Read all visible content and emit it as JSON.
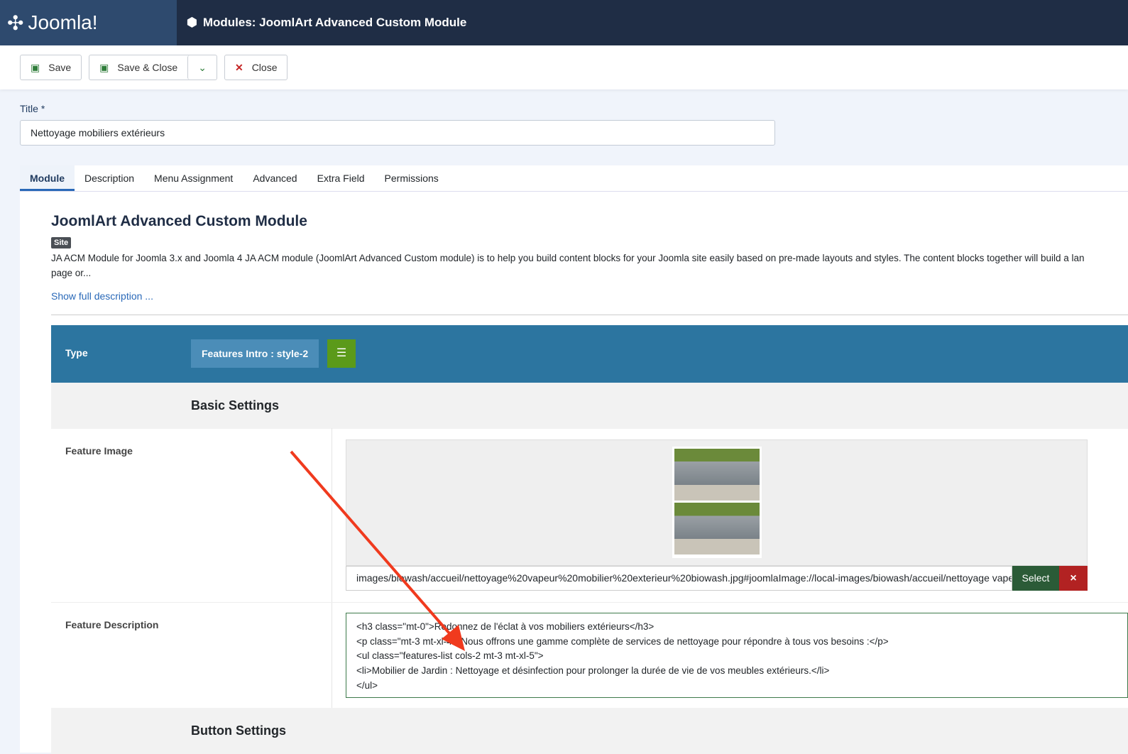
{
  "header": {
    "logo": "Joomla!",
    "title": "Modules: JoomlArt Advanced Custom Module"
  },
  "toolbar": {
    "save": "Save",
    "save_close": "Save & Close",
    "close": "Close"
  },
  "title_label": "Title *",
  "title_value": "Nettoyage mobiliers extérieurs",
  "tabs": [
    "Module",
    "Description",
    "Menu Assignment",
    "Advanced",
    "Extra Field",
    "Permissions"
  ],
  "module": {
    "heading": "JoomlArt Advanced Custom Module",
    "badge": "Site",
    "description_1": "JA ACM Module for Joomla 3.x and Joomla 4 JA ACM module (JoomlArt Advanced Custom module) is to help you build content blocks for your Joomla site easily based on pre-made layouts and styles. The content blocks together will build a lan",
    "description_2": "page or...",
    "show_more": "Show full description ..."
  },
  "type": {
    "label": "Type",
    "value": "Features Intro : style-2"
  },
  "basic_settings": "Basic Settings",
  "feature_image": {
    "label": "Feature Image",
    "path": "images/biowash/accueil/nettoyage%20vapeur%20mobilier%20exterieur%20biowash.jpg#joomlaImage://local-images/biowash/accueil/nettoyage vapeur",
    "select": "Select",
    "clear": "×"
  },
  "feature_description": {
    "label": "Feature Description",
    "lines": [
      "<h3 class=\"mt-0\">Redonnez de l'éclat à vos mobiliers extérieurs</h3>",
      "<p class=\"mt-3 mt-xl-4\">Nous offrons une gamme complète de services de nettoyage pour répondre à tous vos besoins :</p>",
      "<ul class=\"features-list cols-2 mt-3 mt-xl-5\">",
      "<li>Mobilier de Jardin : Nettoyage et désinfection pour prolonger la durée de vie de vos meubles extérieurs.</li>",
      "</ul>"
    ]
  },
  "button_settings": "Button Settings",
  "colors": {
    "annotation_arrow": "#f03a1e"
  }
}
